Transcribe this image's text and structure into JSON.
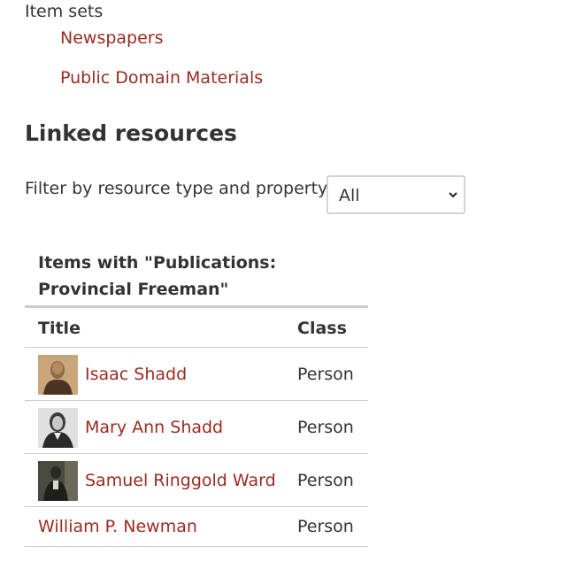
{
  "item_sets": {
    "label": "Item sets",
    "links": [
      "Newspapers",
      "Public Domain Materials"
    ]
  },
  "linked_resources": {
    "title": "Linked resources",
    "filter": {
      "label": "Filter by resource type and property",
      "selected": "All"
    },
    "table": {
      "caption": "Items with \"Publications: Provincial Freeman\"",
      "headers": {
        "title": "Title",
        "class": "Class"
      },
      "rows": [
        {
          "title": "Isaac Shadd",
          "class": "Person",
          "thumbnail": "portrait-thumbnail"
        },
        {
          "title": "Mary Ann Shadd",
          "class": "Person",
          "thumbnail": "portrait-thumbnail"
        },
        {
          "title": "Samuel Ringgold Ward",
          "class": "Person",
          "thumbnail": "portrait-thumbnail"
        },
        {
          "title": "William P. Newman",
          "class": "Person",
          "thumbnail": null
        }
      ]
    }
  },
  "colors": {
    "link": "#9b2a1f",
    "text": "#333333",
    "border": "#cccccc"
  },
  "icons": {
    "select_chevron": "chevron-down-icon"
  }
}
